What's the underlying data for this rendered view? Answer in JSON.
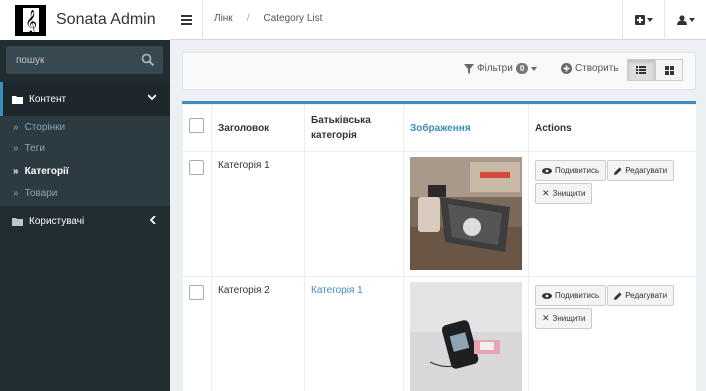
{
  "app": {
    "title": "Sonata Admin"
  },
  "breadcrumb": {
    "link": "Лінк",
    "separator": "/",
    "current": "Category List"
  },
  "sidebar": {
    "search_placeholder": "пошук",
    "content_section": "Контент",
    "items": [
      {
        "label": "Сторінки"
      },
      {
        "label": "Теги"
      },
      {
        "label": "Категорії"
      },
      {
        "label": "Товари"
      }
    ],
    "users_section": "Користувачі"
  },
  "actions": {
    "filters_label": "Фільтри",
    "filters_count": "0",
    "create_label": "Створить"
  },
  "table": {
    "columns": [
      "Заголовок",
      "Батьківська категорія",
      "Зображення",
      "Actions"
    ],
    "rows": [
      {
        "title": "Категорія 1",
        "parent": "",
        "image": "tools-on-workbench"
      },
      {
        "title": "Категорія 2",
        "parent": "Категорія 1",
        "image": "device-on-table"
      }
    ],
    "buttons": {
      "view": "Подивитись",
      "edit": "Редагувати",
      "delete": "Знищити"
    }
  },
  "colors": {
    "accent": "#3c8dbc",
    "sidebar_bg": "#222d32"
  }
}
